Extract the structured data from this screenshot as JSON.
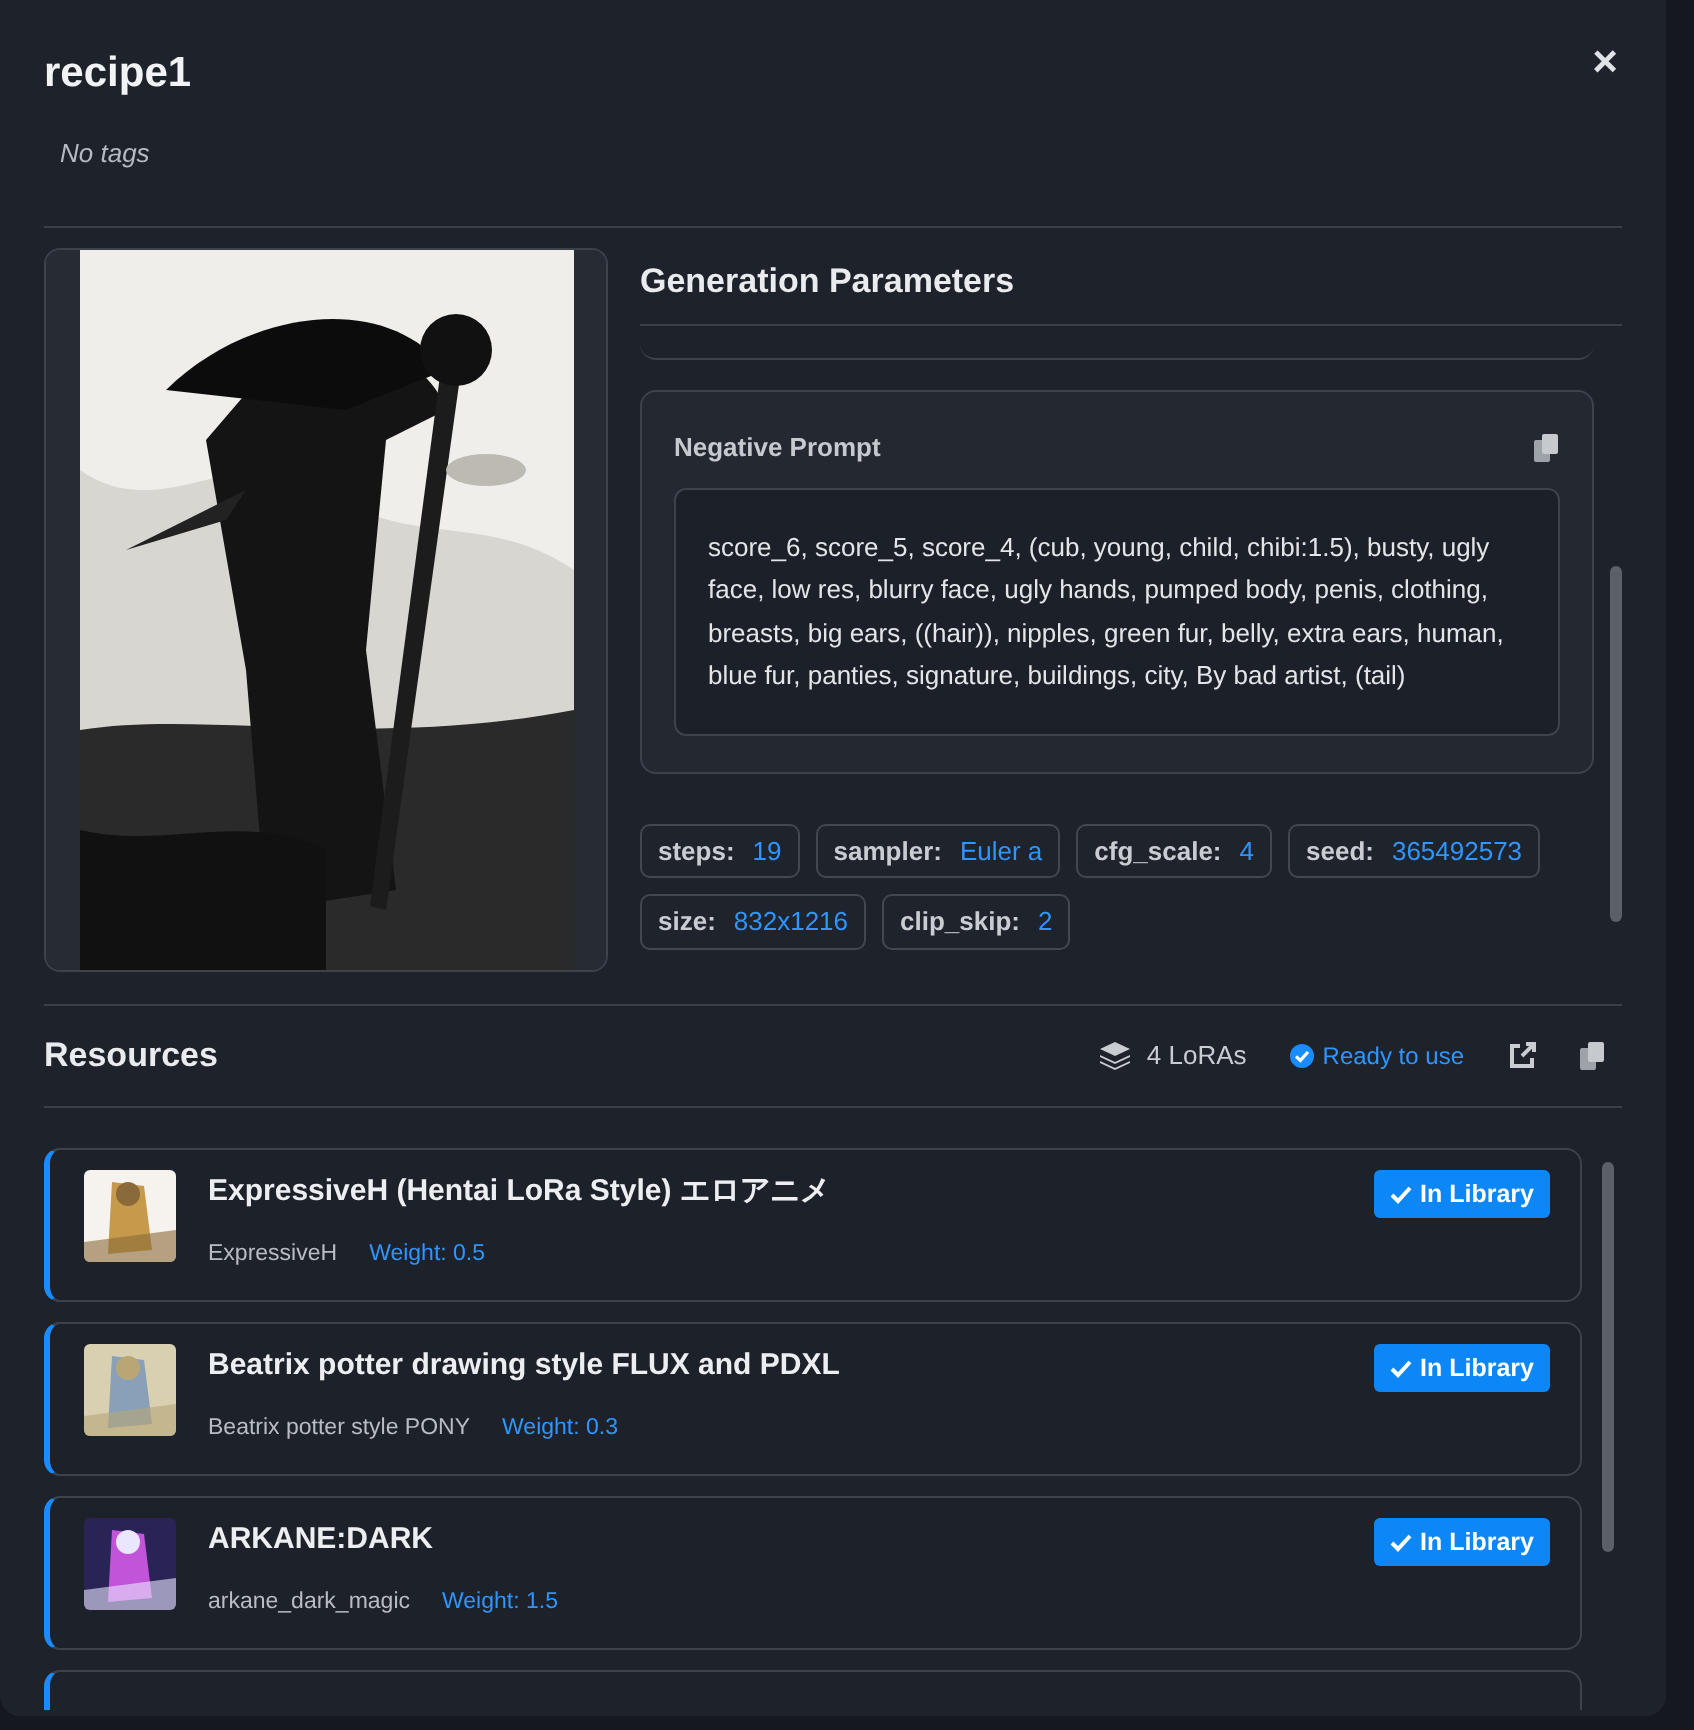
{
  "modal": {
    "title": "recipe1",
    "tags_text": "No tags",
    "close": "×"
  },
  "parameters": {
    "heading": "Generation Parameters",
    "negative_prompt": {
      "label": "Negative Prompt",
      "text": "score_6, score_5, score_4, (cub, young, child, chibi:1.5), busty, ugly face, low res, blurry face, ugly hands, pumped body, penis, clothing, breasts, big ears, ((hair)), nipples, green fur, belly, extra ears, human, blue fur, panties, signature, buildings, city, By bad artist, (tail)"
    },
    "items": [
      {
        "key": "steps:",
        "value": "19"
      },
      {
        "key": "sampler:",
        "value": "Euler a"
      },
      {
        "key": "cfg_scale:",
        "value": "4"
      },
      {
        "key": "seed:",
        "value": "365492573"
      },
      {
        "key": "size:",
        "value": "832x1216"
      },
      {
        "key": "clip_skip:",
        "value": "2"
      }
    ]
  },
  "resources": {
    "heading": "Resources",
    "count": "4 LoRAs",
    "status": "Ready to use",
    "loras": [
      {
        "name": "ExpressiveH (Hentai LoRa Style) エロアニメ",
        "version": "ExpressiveH",
        "weight": "Weight: 0.5",
        "in_library": true,
        "badge": "In Library"
      },
      {
        "name": "Beatrix potter drawing style FLUX and PDXL",
        "version": "Beatrix potter style PONY",
        "weight": "Weight: 0.3",
        "in_library": true,
        "badge": "In Library"
      },
      {
        "name": "ARKANE:DARK",
        "version": "arkane_dark_magic",
        "weight": "Weight: 1.5",
        "in_library": true,
        "badge": "In Library"
      }
    ]
  }
}
